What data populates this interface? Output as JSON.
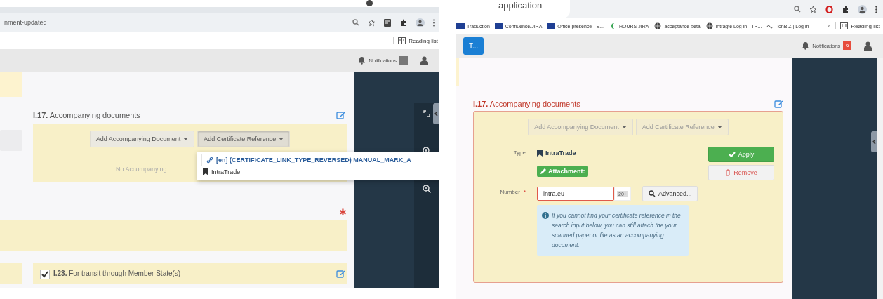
{
  "left_window": {
    "browser": {
      "url": "nment-updated",
      "reading_list": "Reading list"
    },
    "header": {
      "notifications": "Notifications"
    },
    "section": {
      "number": "I.17.",
      "title": "Accompanying documents",
      "buttons": [
        {
          "label": "Add Accompanying Document",
          "open": false
        },
        {
          "label": "Add Certificate Reference",
          "open": true
        }
      ],
      "empty_text": "No Accompanying"
    },
    "dropdown": {
      "items": [
        {
          "kind": "link",
          "label": "[en] (CERTIFICATE_LINK_TYPE_REVERSED) MANUAL_MARK_A",
          "selected": true
        },
        {
          "kind": "bookmark",
          "label": "IntraTrade",
          "selected": false
        }
      ]
    },
    "required_mark": "✱",
    "next_section": {
      "checked": true,
      "number": "I.23.",
      "title": "For transit through Member State(s)"
    }
  },
  "right_window": {
    "browser": {
      "tab_title": "application",
      "bookmarks": [
        {
          "kind": "flag",
          "label": "Traduction"
        },
        {
          "kind": "flag",
          "label": "Confluence/JIRA"
        },
        {
          "kind": "flag",
          "label": "Office presence - S..."
        },
        {
          "kind": "moon",
          "label": "HOURS JIRA"
        },
        {
          "kind": "globe",
          "label": "acceptance beta"
        },
        {
          "kind": "globe",
          "label": "intragte Log in - TR..."
        },
        {
          "kind": "wave",
          "label": "ionBIZ | Log in"
        }
      ],
      "more": "»",
      "reading_list": "Reading list"
    },
    "header": {
      "app_button": "T...",
      "notifications": "Notifications",
      "notification_count": "6"
    },
    "section": {
      "number": "I.17.",
      "title": "Accompanying documents",
      "buttons": [
        {
          "label": "Add Accompanying Document",
          "open": false
        },
        {
          "label": "Add Certificate Reference",
          "open": false
        }
      ],
      "type_label": "Type",
      "type_value": "IntraTrade",
      "attachment": "Attachment:",
      "apply": "Apply",
      "remove": "Remove",
      "number_label": "Number",
      "required_mark": "*",
      "number_value": "intra.eu",
      "counter": "20+",
      "advanced": "Advanced...",
      "info": "If you cannot find your certificate reference in the search input below, you can still attach the your scanned paper or file as an accompanying document."
    }
  }
}
